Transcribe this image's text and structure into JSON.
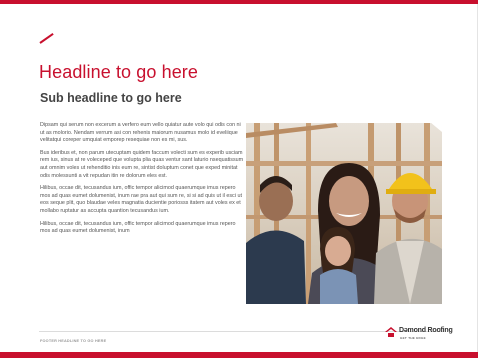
{
  "document": {
    "headline": "Headline to go here",
    "subheadline": "Sub headline to go here",
    "paragraphs": [
      "Dipsam qui serum non excerum a verfero eum vello quiatur aute volo qui odis con ni ut as molorio. Nendam verrum asi con rehenis maiorum nusamus molo id eveliique velitatqui coreper umquiat emporep resequiae non es mi, sus.",
      "Bus ideribus et, non parum utecuptam quidem faccum volecti sum es experib usciam rem ius, sinus at re voleceped que volupta plia quas ventur sant laturio nsequatissum aut omnim voles ut rehenditio inis eum re, sintist doluptum conet que exped minitat odis molessunti a vit repudan itin re dolorum eles est.",
      "Hilibus, occae dit, tecusandus ium, offic tempor alicimod quaerumque imus repero mos ad quas eumet dolumenist, inum rae pra aut qui sum re, si si ad quis ut il esci ut eos seque plit, quo blaudae veles magnatia ducientie poriosss itatem aut voles ex et mollabo ruptatur as accupta quantion tecusandus ium.",
      "Hilibus, occae dit, tecusandus ium, offic tempor alicimod quaerumque imus repero mos ad quas eumet dolumenist, inum"
    ]
  },
  "footer": {
    "text": "FOOTER HEADLINE TO GO HERE"
  },
  "logo": {
    "name": "Dǝmond Roofing",
    "tagline": "GET THE EDGE",
    "icon": "house-roof-icon"
  },
  "colors": {
    "accent": "#c8102e",
    "body_text": "#555555",
    "footer_text": "#9a9a9a"
  }
}
